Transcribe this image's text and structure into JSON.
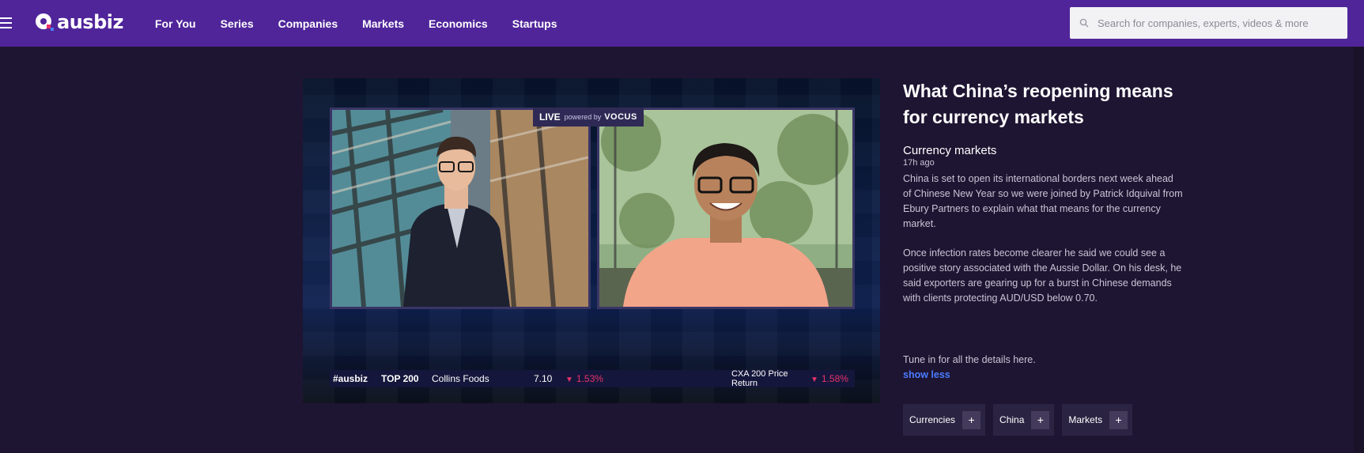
{
  "header": {
    "logo_text": "ausbiz",
    "nav": [
      "For You",
      "Series",
      "Companies",
      "Markets",
      "Economics",
      "Startups"
    ],
    "search_placeholder": "Search for companies, experts, videos & more",
    "icons": [
      "menu-icon",
      "search-icon"
    ],
    "colors": {
      "header_bg": "#50259a",
      "page_bg": "#1e1532"
    }
  },
  "video": {
    "live_label": "LIVE",
    "powered_label": "powered by",
    "sponsor": "VOCUS",
    "ticker": {
      "brand": "#ausbiz",
      "index": "TOP 200",
      "stock": "Collins Foods",
      "price": "7.10",
      "change": "1.53%",
      "index2": "CXA 200 Price Return",
      "change2": "1.58%"
    }
  },
  "article": {
    "title": "What China’s reopening means for currency markets",
    "category": "Currency markets",
    "time": "17h ago",
    "paragraphs": [
      "China is set to open its international borders next week ahead of Chinese New Year so we were joined by Patrick Idquival from Ebury Partners to explain what that means for the currency market.",
      "Once infection rates become clearer he said we could see a positive story associated with the Aussie Dollar. On his desk, he said exporters are gearing up for a burst in Chinese demands with clients protecting AUD/USD below 0.70."
    ],
    "tune_in": "Tune in for all the details here.",
    "show_less": "show less",
    "tags": [
      "Currencies",
      "China",
      "Markets"
    ],
    "tag_action": "+",
    "colors": {
      "link": "#4a7cff",
      "down": "#e8336a"
    }
  }
}
